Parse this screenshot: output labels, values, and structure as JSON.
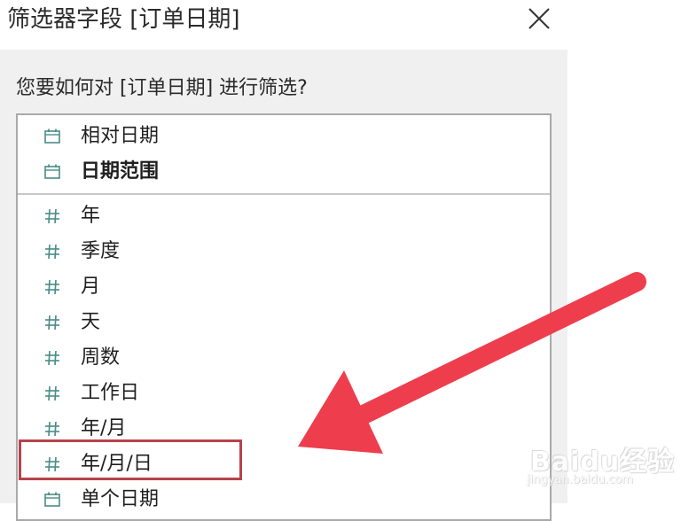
{
  "dialog": {
    "title": "筛选器字段 [订单日期]",
    "question": "您要如何对 [订单日期] 进行筛选?"
  },
  "options": [
    {
      "label": "相对日期",
      "icon": "calendar-icon",
      "bold": false
    },
    {
      "label": "日期范围",
      "icon": "calendar-icon",
      "bold": true
    },
    {
      "label": "年",
      "icon": "hash-icon",
      "bold": false
    },
    {
      "label": "季度",
      "icon": "hash-icon",
      "bold": false
    },
    {
      "label": "月",
      "icon": "hash-icon",
      "bold": false
    },
    {
      "label": "天",
      "icon": "hash-icon",
      "bold": false
    },
    {
      "label": "周数",
      "icon": "hash-icon",
      "bold": false
    },
    {
      "label": "工作日",
      "icon": "hash-icon",
      "bold": false
    },
    {
      "label": "年/月",
      "icon": "hash-icon",
      "bold": false
    },
    {
      "label": "年/月/日",
      "icon": "hash-icon",
      "bold": false,
      "highlighted": true
    },
    {
      "label": "单个日期",
      "icon": "calendar-icon",
      "bold": false
    }
  ],
  "colors": {
    "icon": "#4a8c86",
    "highlight_border": "#b7434b",
    "annotation_arrow": "#ee3e4e"
  },
  "watermark": {
    "logo": "Baidu经验",
    "url": "jingyan.baidu.com"
  }
}
